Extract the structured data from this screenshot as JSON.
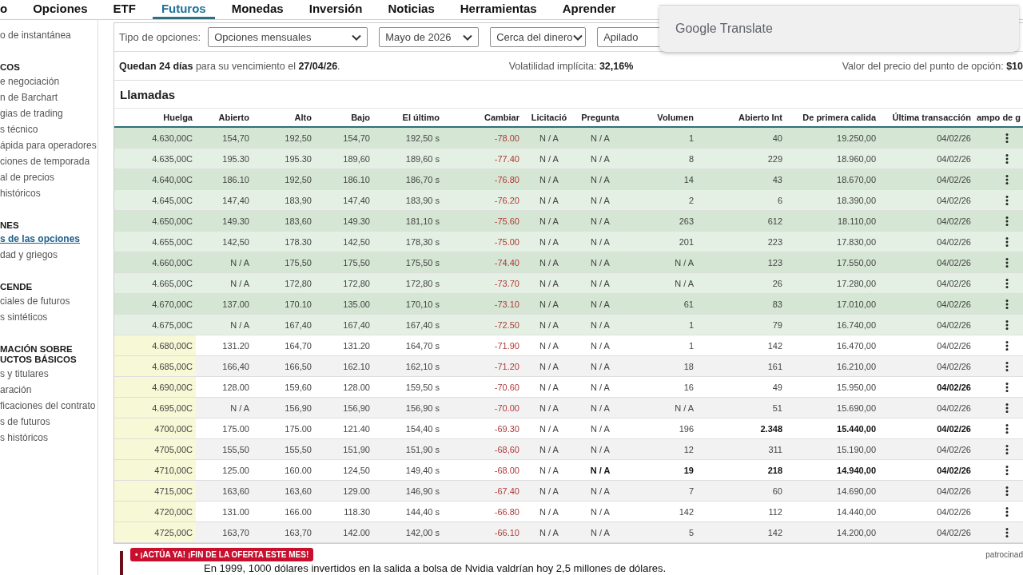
{
  "nav": {
    "items": [
      {
        "label": "o",
        "selected": false
      },
      {
        "label": "Opciones",
        "selected": false
      },
      {
        "label": "ETF",
        "selected": false
      },
      {
        "label": "Futuros",
        "selected": true
      },
      {
        "label": "Monedas",
        "selected": false
      },
      {
        "label": "Inversión",
        "selected": false
      },
      {
        "label": "Noticias",
        "selected": false
      },
      {
        "label": "Herramientas",
        "selected": false
      },
      {
        "label": "Aprender",
        "selected": false
      }
    ]
  },
  "sidebar": {
    "sections": [
      {
        "items": [
          {
            "label": "o de instantánea",
            "selected": false
          }
        ]
      },
      {
        "heading": [
          "COS"
        ],
        "items": [
          {
            "label": "e negociación",
            "selected": false
          },
          {
            "label": "n de Barchart",
            "selected": false
          },
          {
            "label": "gias de trading",
            "selected": false
          },
          {
            "label": "s técnico",
            "selected": false
          },
          {
            "label": "ápida para operadores",
            "selected": false
          },
          {
            "label": "ciones de temporada",
            "selected": false
          },
          {
            "label": "al de precios",
            "selected": false
          },
          {
            "label": "históricos",
            "selected": false
          }
        ]
      },
      {
        "heading": [
          "NES"
        ],
        "items": [
          {
            "label": "s de las opciones",
            "selected": true
          },
          {
            "label": "dad y griegos",
            "selected": false
          }
        ]
      },
      {
        "heading": [
          "CENDE"
        ],
        "items": [
          {
            "label": "ciales de futuros",
            "selected": false
          },
          {
            "label": "s sintéticos",
            "selected": false
          }
        ]
      },
      {
        "heading": [
          "MACIÓN SOBRE",
          "UCTOS BÁSICOS"
        ],
        "items": [
          {
            "label": "s y titulares",
            "selected": false
          },
          {
            "label": "aración",
            "selected": false
          },
          {
            "label": "ficaciones del contrato",
            "selected": false
          },
          {
            "label": "s de futuros",
            "selected": false
          },
          {
            "label": "s históricos",
            "selected": false
          }
        ]
      }
    ]
  },
  "filters": {
    "label": "Tipo de opciones:",
    "selects": [
      {
        "value": "Opciones mensuales",
        "caret": true
      },
      {
        "value": "Mayo de 2026",
        "caret": true
      },
      {
        "value": "Cerca del dinero",
        "caret": true
      },
      {
        "value": "Apilado",
        "caret": false
      }
    ]
  },
  "summary": {
    "expiry": "**Quedan 24 días** para su vencimiento el **27/04/26**.",
    "volatility": "Volatilidad implícita: **32,16%**",
    "point_value": "Valor del precio del punto de opción: **$10**"
  },
  "table": {
    "title": "Llamadas",
    "columns": [
      {
        "label": "Huelga",
        "kind": "strike"
      },
      {
        "label": "Abierto",
        "kind": "number"
      },
      {
        "label": "Alto",
        "kind": "number"
      },
      {
        "label": "Bajo",
        "kind": "number"
      },
      {
        "label": "El último",
        "kind": "number"
      },
      {
        "label": "Cambiar",
        "kind": "change"
      },
      {
        "label": "Licitació",
        "kind": "quote"
      },
      {
        "label": "Pregunta",
        "kind": "quote"
      },
      {
        "label": "Volumen",
        "kind": "number"
      },
      {
        "label": "Abierto Int",
        "kind": "number"
      },
      {
        "label": "De primera calida",
        "kind": "number"
      },
      {
        "label": "Última transacción",
        "kind": "number"
      },
      {
        "label": "ampo de g",
        "kind": "menu"
      }
    ],
    "rows": [
      {
        "in_the_money": true,
        "cells": [
          {
            "text": "4.630,00C",
            "bold": false
          },
          {
            "text": "154,70",
            "bold": false
          },
          {
            "text": "192,50",
            "bold": false
          },
          {
            "text": "154,70",
            "bold": false
          },
          {
            "text": "192,50 s",
            "bold": false
          },
          {
            "text": "-78.00",
            "bold": false
          },
          {
            "text": "N / A",
            "bold": false
          },
          {
            "text": "N / A",
            "bold": false
          },
          {
            "text": "1",
            "bold": false
          },
          {
            "text": "40",
            "bold": false
          },
          {
            "text": "19.250,00",
            "bold": false
          },
          {
            "text": "04/02/26",
            "bold": false
          }
        ]
      },
      {
        "in_the_money": true,
        "cells": [
          {
            "text": "4.635,00C",
            "bold": false
          },
          {
            "text": "195.30",
            "bold": false
          },
          {
            "text": "195.30",
            "bold": false
          },
          {
            "text": "189,60",
            "bold": false
          },
          {
            "text": "189,60 s",
            "bold": false
          },
          {
            "text": "-77.40",
            "bold": false
          },
          {
            "text": "N / A",
            "bold": false
          },
          {
            "text": "N / A",
            "bold": false
          },
          {
            "text": "8",
            "bold": false
          },
          {
            "text": "229",
            "bold": false
          },
          {
            "text": "18.960,00",
            "bold": false
          },
          {
            "text": "04/02/26",
            "bold": false
          }
        ]
      },
      {
        "in_the_money": true,
        "cells": [
          {
            "text": "4.640,00C",
            "bold": false
          },
          {
            "text": "186.10",
            "bold": false
          },
          {
            "text": "192,50",
            "bold": false
          },
          {
            "text": "186.10",
            "bold": false
          },
          {
            "text": "186,70 s",
            "bold": false
          },
          {
            "text": "-76.80",
            "bold": false
          },
          {
            "text": "N / A",
            "bold": false
          },
          {
            "text": "N / A",
            "bold": false
          },
          {
            "text": "14",
            "bold": false
          },
          {
            "text": "43",
            "bold": false
          },
          {
            "text": "18.670,00",
            "bold": false
          },
          {
            "text": "04/02/26",
            "bold": false
          }
        ]
      },
      {
        "in_the_money": true,
        "cells": [
          {
            "text": "4.645,00C",
            "bold": false
          },
          {
            "text": "147,40",
            "bold": false
          },
          {
            "text": "183,90",
            "bold": false
          },
          {
            "text": "147,40",
            "bold": false
          },
          {
            "text": "183,90 s",
            "bold": false
          },
          {
            "text": "-76.20",
            "bold": false
          },
          {
            "text": "N / A",
            "bold": false
          },
          {
            "text": "N / A",
            "bold": false
          },
          {
            "text": "2",
            "bold": false
          },
          {
            "text": "6",
            "bold": false
          },
          {
            "text": "18.390,00",
            "bold": false
          },
          {
            "text": "04/02/26",
            "bold": false
          }
        ]
      },
      {
        "in_the_money": true,
        "cells": [
          {
            "text": "4.650,00C",
            "bold": false
          },
          {
            "text": "149.30",
            "bold": false
          },
          {
            "text": "183,60",
            "bold": false
          },
          {
            "text": "149.30",
            "bold": false
          },
          {
            "text": "181,10 s",
            "bold": false
          },
          {
            "text": "-75.60",
            "bold": false
          },
          {
            "text": "N / A",
            "bold": false
          },
          {
            "text": "N / A",
            "bold": false
          },
          {
            "text": "263",
            "bold": false
          },
          {
            "text": "612",
            "bold": false
          },
          {
            "text": "18.110,00",
            "bold": false
          },
          {
            "text": "04/02/26",
            "bold": false
          }
        ]
      },
      {
        "in_the_money": true,
        "cells": [
          {
            "text": "4.655,00C",
            "bold": false
          },
          {
            "text": "142,50",
            "bold": false
          },
          {
            "text": "178.30",
            "bold": false
          },
          {
            "text": "142,50",
            "bold": false
          },
          {
            "text": "178,30 s",
            "bold": false
          },
          {
            "text": "-75.00",
            "bold": false
          },
          {
            "text": "N / A",
            "bold": false
          },
          {
            "text": "N / A",
            "bold": false
          },
          {
            "text": "201",
            "bold": false
          },
          {
            "text": "223",
            "bold": false
          },
          {
            "text": "17.830,00",
            "bold": false
          },
          {
            "text": "04/02/26",
            "bold": false
          }
        ]
      },
      {
        "in_the_money": true,
        "cells": [
          {
            "text": "4.660,00C",
            "bold": false
          },
          {
            "text": "N / A",
            "bold": false
          },
          {
            "text": "175,50",
            "bold": false
          },
          {
            "text": "175,50",
            "bold": false
          },
          {
            "text": "175,50 s",
            "bold": false
          },
          {
            "text": "-74.40",
            "bold": false
          },
          {
            "text": "N / A",
            "bold": false
          },
          {
            "text": "N / A",
            "bold": false
          },
          {
            "text": "N / A",
            "bold": false
          },
          {
            "text": "123",
            "bold": false
          },
          {
            "text": "17.550,00",
            "bold": false
          },
          {
            "text": "04/02/26",
            "bold": false
          }
        ]
      },
      {
        "in_the_money": true,
        "cells": [
          {
            "text": "4.665,00C",
            "bold": false
          },
          {
            "text": "N / A",
            "bold": false
          },
          {
            "text": "172,80",
            "bold": false
          },
          {
            "text": "172,80",
            "bold": false
          },
          {
            "text": "172,80 s",
            "bold": false
          },
          {
            "text": "-73.70",
            "bold": false
          },
          {
            "text": "N / A",
            "bold": false
          },
          {
            "text": "N / A",
            "bold": false
          },
          {
            "text": "N / A",
            "bold": false
          },
          {
            "text": "26",
            "bold": false
          },
          {
            "text": "17.280,00",
            "bold": false
          },
          {
            "text": "04/02/26",
            "bold": false
          }
        ]
      },
      {
        "in_the_money": true,
        "cells": [
          {
            "text": "4.670,00C",
            "bold": false
          },
          {
            "text": "137.00",
            "bold": false
          },
          {
            "text": "170.10",
            "bold": false
          },
          {
            "text": "135.00",
            "bold": false
          },
          {
            "text": "170,10 s",
            "bold": false
          },
          {
            "text": "-73.10",
            "bold": false
          },
          {
            "text": "N / A",
            "bold": false
          },
          {
            "text": "N / A",
            "bold": false
          },
          {
            "text": "61",
            "bold": false
          },
          {
            "text": "83",
            "bold": false
          },
          {
            "text": "17.010,00",
            "bold": false
          },
          {
            "text": "04/02/26",
            "bold": false
          }
        ]
      },
      {
        "in_the_money": true,
        "cells": [
          {
            "text": "4.675,00C",
            "bold": false
          },
          {
            "text": "N / A",
            "bold": false
          },
          {
            "text": "167,40",
            "bold": false
          },
          {
            "text": "167,40",
            "bold": false
          },
          {
            "text": "167,40 s",
            "bold": false
          },
          {
            "text": "-72.50",
            "bold": false
          },
          {
            "text": "N / A",
            "bold": false
          },
          {
            "text": "N / A",
            "bold": false
          },
          {
            "text": "1",
            "bold": false
          },
          {
            "text": "79",
            "bold": false
          },
          {
            "text": "16.740,00",
            "bold": false
          },
          {
            "text": "04/02/26",
            "bold": false
          }
        ]
      },
      {
        "in_the_money": false,
        "cells": [
          {
            "text": "4.680,00C",
            "bold": false
          },
          {
            "text": "131.20",
            "bold": false
          },
          {
            "text": "164,70",
            "bold": false
          },
          {
            "text": "131.20",
            "bold": false
          },
          {
            "text": "164,70 s",
            "bold": false
          },
          {
            "text": "-71.90",
            "bold": false
          },
          {
            "text": "N / A",
            "bold": false
          },
          {
            "text": "N / A",
            "bold": false
          },
          {
            "text": "1",
            "bold": false
          },
          {
            "text": "142",
            "bold": false
          },
          {
            "text": "16.470,00",
            "bold": false
          },
          {
            "text": "04/02/26",
            "bold": false
          }
        ]
      },
      {
        "in_the_money": false,
        "cells": [
          {
            "text": "4.685,00C",
            "bold": false
          },
          {
            "text": "166,40",
            "bold": false
          },
          {
            "text": "166,50",
            "bold": false
          },
          {
            "text": "162.10",
            "bold": false
          },
          {
            "text": "162,10 s",
            "bold": false
          },
          {
            "text": "-71.20",
            "bold": false
          },
          {
            "text": "N / A",
            "bold": false
          },
          {
            "text": "N / A",
            "bold": false
          },
          {
            "text": "18",
            "bold": false
          },
          {
            "text": "161",
            "bold": false
          },
          {
            "text": "16.210,00",
            "bold": false
          },
          {
            "text": "04/02/26",
            "bold": false
          }
        ]
      },
      {
        "in_the_money": false,
        "cells": [
          {
            "text": "4.690,00C",
            "bold": false
          },
          {
            "text": "128.00",
            "bold": false
          },
          {
            "text": "159,60",
            "bold": false
          },
          {
            "text": "128.00",
            "bold": false
          },
          {
            "text": "159,50 s",
            "bold": false
          },
          {
            "text": "-70.60",
            "bold": false
          },
          {
            "text": "N / A",
            "bold": false
          },
          {
            "text": "N / A",
            "bold": false
          },
          {
            "text": "16",
            "bold": false
          },
          {
            "text": "49",
            "bold": false
          },
          {
            "text": "15.950,00",
            "bold": false
          },
          {
            "text": "04/02/26",
            "bold": true
          }
        ]
      },
      {
        "in_the_money": false,
        "cells": [
          {
            "text": "4.695,00C",
            "bold": false
          },
          {
            "text": "N / A",
            "bold": false
          },
          {
            "text": "156,90",
            "bold": false
          },
          {
            "text": "156,90",
            "bold": false
          },
          {
            "text": "156,90 s",
            "bold": false
          },
          {
            "text": "-70.00",
            "bold": false
          },
          {
            "text": "N / A",
            "bold": false
          },
          {
            "text": "N / A",
            "bold": false
          },
          {
            "text": "N / A",
            "bold": false
          },
          {
            "text": "51",
            "bold": false
          },
          {
            "text": "15.690,00",
            "bold": false
          },
          {
            "text": "04/02/26",
            "bold": false
          }
        ]
      },
      {
        "in_the_money": false,
        "cells": [
          {
            "text": "4700,00C",
            "bold": false
          },
          {
            "text": "175.00",
            "bold": false
          },
          {
            "text": "175.00",
            "bold": false
          },
          {
            "text": "121.40",
            "bold": false
          },
          {
            "text": "154,40 s",
            "bold": false
          },
          {
            "text": "-69.30",
            "bold": false
          },
          {
            "text": "N / A",
            "bold": false
          },
          {
            "text": "N / A",
            "bold": false
          },
          {
            "text": "196",
            "bold": false
          },
          {
            "text": "2.348",
            "bold": true
          },
          {
            "text": "15.440,00",
            "bold": true
          },
          {
            "text": "04/02/26",
            "bold": true
          }
        ]
      },
      {
        "in_the_money": false,
        "cells": [
          {
            "text": "4705,00C",
            "bold": false
          },
          {
            "text": "155,50",
            "bold": false
          },
          {
            "text": "155,50",
            "bold": false
          },
          {
            "text": "151,90",
            "bold": false
          },
          {
            "text": "151,90 s",
            "bold": false
          },
          {
            "text": "-68,60",
            "bold": false
          },
          {
            "text": "N / A",
            "bold": false
          },
          {
            "text": "N / A",
            "bold": false
          },
          {
            "text": "12",
            "bold": false
          },
          {
            "text": "311",
            "bold": false
          },
          {
            "text": "15.190,00",
            "bold": false
          },
          {
            "text": "04/02/26",
            "bold": false
          }
        ]
      },
      {
        "in_the_money": false,
        "cells": [
          {
            "text": "4710,00C",
            "bold": false
          },
          {
            "text": "125.00",
            "bold": false
          },
          {
            "text": "160.00",
            "bold": false
          },
          {
            "text": "124,50",
            "bold": false
          },
          {
            "text": "149,40 s",
            "bold": false
          },
          {
            "text": "-68.00",
            "bold": false
          },
          {
            "text": "N / A",
            "bold": false
          },
          {
            "text": "N / A",
            "bold": true
          },
          {
            "text": "19",
            "bold": true
          },
          {
            "text": "218",
            "bold": true
          },
          {
            "text": "14.940,00",
            "bold": true
          },
          {
            "text": "04/02/26",
            "bold": true
          }
        ]
      },
      {
        "in_the_money": false,
        "cells": [
          {
            "text": "4715,00C",
            "bold": false
          },
          {
            "text": "163,60",
            "bold": false
          },
          {
            "text": "163,60",
            "bold": false
          },
          {
            "text": "129.00",
            "bold": false
          },
          {
            "text": "146,90 s",
            "bold": false
          },
          {
            "text": "-67.40",
            "bold": false
          },
          {
            "text": "N / A",
            "bold": false
          },
          {
            "text": "N / A",
            "bold": false
          },
          {
            "text": "7",
            "bold": false
          },
          {
            "text": "60",
            "bold": false
          },
          {
            "text": "14.690,00",
            "bold": false
          },
          {
            "text": "04/02/26",
            "bold": false
          }
        ]
      },
      {
        "in_the_money": false,
        "cells": [
          {
            "text": "4720,00C",
            "bold": false
          },
          {
            "text": "131.00",
            "bold": false
          },
          {
            "text": "166.00",
            "bold": false
          },
          {
            "text": "118.30",
            "bold": false
          },
          {
            "text": "144,40 s",
            "bold": false
          },
          {
            "text": "-66.80",
            "bold": false
          },
          {
            "text": "N / A",
            "bold": false
          },
          {
            "text": "N / A",
            "bold": false
          },
          {
            "text": "142",
            "bold": false
          },
          {
            "text": "112",
            "bold": false
          },
          {
            "text": "14.440,00",
            "bold": false
          },
          {
            "text": "04/02/26",
            "bold": false
          }
        ]
      },
      {
        "in_the_money": false,
        "cells": [
          {
            "text": "4725,00C",
            "bold": false
          },
          {
            "text": "163,70",
            "bold": false
          },
          {
            "text": "163,70",
            "bold": false
          },
          {
            "text": "142.00",
            "bold": false
          },
          {
            "text": "142,00 s",
            "bold": false
          },
          {
            "text": "-66.10",
            "bold": false
          },
          {
            "text": "N / A",
            "bold": false
          },
          {
            "text": "N / A",
            "bold": false
          },
          {
            "text": "5",
            "bold": false
          },
          {
            "text": "142",
            "bold": false
          },
          {
            "text": "14.200,00",
            "bold": false
          },
          {
            "text": "04/02/26",
            "bold": false
          }
        ]
      }
    ]
  },
  "promo": {
    "badge": "• ¡ACTÚA YA! ¡FIN DE LA OFERTA ESTE MES!",
    "sponsor": "patrocinad",
    "headline": "En 1999, 1000 dólares invertidos en la salida a bolsa de Nvidia valdrían hoy 2,5 millones de dólares."
  },
  "translate_popup": {
    "title": "Google Translate"
  }
}
